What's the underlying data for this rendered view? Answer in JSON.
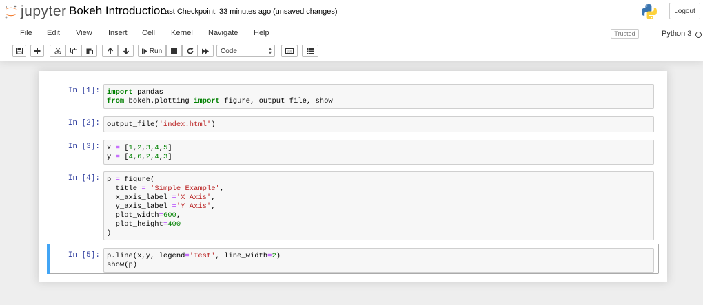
{
  "header": {
    "logo_text": "jupyter",
    "notebook_name": "Bokeh Introduction",
    "checkpoint": "Last Checkpoint: 33 minutes ago",
    "autosave_status": "(unsaved changes)",
    "logout_label": "Logout"
  },
  "menu": {
    "items": [
      "File",
      "Edit",
      "View",
      "Insert",
      "Cell",
      "Kernel",
      "Navigate",
      "Help"
    ],
    "trusted": "Trusted",
    "kernel_name": "Python 3"
  },
  "toolbar": {
    "run_label": "Run",
    "cell_type": "Code",
    "icons": [
      "save-icon",
      "plus-icon",
      "cut-icon",
      "copy-icon",
      "paste-icon",
      "arrow-up-icon",
      "arrow-down-icon",
      "step-forward-icon",
      "stop-icon",
      "restart-icon",
      "fast-forward-icon",
      "keyboard-icon",
      "list-icon"
    ]
  },
  "cells": [
    {
      "prompt": "In [1]:",
      "code": [
        [
          "import",
          "kw"
        ],
        [
          " pandas\n",
          ""
        ],
        [
          "from",
          "kw"
        ],
        [
          " bokeh.plotting ",
          ""
        ],
        [
          "import",
          "kw"
        ],
        [
          " figure, output_file, show",
          ""
        ]
      ]
    },
    {
      "prompt": "In [2]:",
      "code": [
        [
          "output_file(",
          ""
        ],
        [
          "'index.html'",
          "st"
        ],
        [
          ")",
          ""
        ]
      ]
    },
    {
      "prompt": "In [3]:",
      "code": [
        [
          "x ",
          ""
        ],
        [
          "=",
          "op"
        ],
        [
          " [",
          ""
        ],
        [
          "1",
          "nm"
        ],
        [
          ",",
          ""
        ],
        [
          "2",
          "nm"
        ],
        [
          ",",
          ""
        ],
        [
          "3",
          "nm"
        ],
        [
          ",",
          ""
        ],
        [
          "4",
          "nm"
        ],
        [
          ",",
          ""
        ],
        [
          "5",
          "nm"
        ],
        [
          "]\ny ",
          ""
        ],
        [
          "=",
          "op"
        ],
        [
          " [",
          ""
        ],
        [
          "4",
          "nm"
        ],
        [
          ",",
          ""
        ],
        [
          "6",
          "nm"
        ],
        [
          ",",
          ""
        ],
        [
          "2",
          "nm"
        ],
        [
          ",",
          ""
        ],
        [
          "4",
          "nm"
        ],
        [
          ",",
          ""
        ],
        [
          "3",
          "nm"
        ],
        [
          "]",
          ""
        ]
      ]
    },
    {
      "prompt": "In [4]:",
      "code": [
        [
          "p ",
          ""
        ],
        [
          "=",
          "op"
        ],
        [
          " figure(\n  title ",
          ""
        ],
        [
          "=",
          "op"
        ],
        [
          " ",
          ""
        ],
        [
          "'Simple Example'",
          "st"
        ],
        [
          ",\n  x_axis_label ",
          ""
        ],
        [
          "=",
          "op"
        ],
        [
          "'X Axis'",
          "st"
        ],
        [
          ",\n  y_axis_label ",
          ""
        ],
        [
          "=",
          "op"
        ],
        [
          "'Y Axis'",
          "st"
        ],
        [
          ",\n  plot_width",
          ""
        ],
        [
          "=",
          "op"
        ],
        [
          "600",
          "nm"
        ],
        [
          ",\n  plot_height",
          ""
        ],
        [
          "=",
          "op"
        ],
        [
          "400",
          "nm"
        ],
        [
          "\n)",
          ""
        ]
      ]
    },
    {
      "prompt": "In [5]:",
      "code": [
        [
          "p.line(x,y, legend",
          ""
        ],
        [
          "=",
          "op"
        ],
        [
          "'Test'",
          "st"
        ],
        [
          ", line_width",
          ""
        ],
        [
          "=",
          "op"
        ],
        [
          "2",
          "nm"
        ],
        [
          ")\nshow(p)",
          ""
        ]
      ]
    }
  ]
}
